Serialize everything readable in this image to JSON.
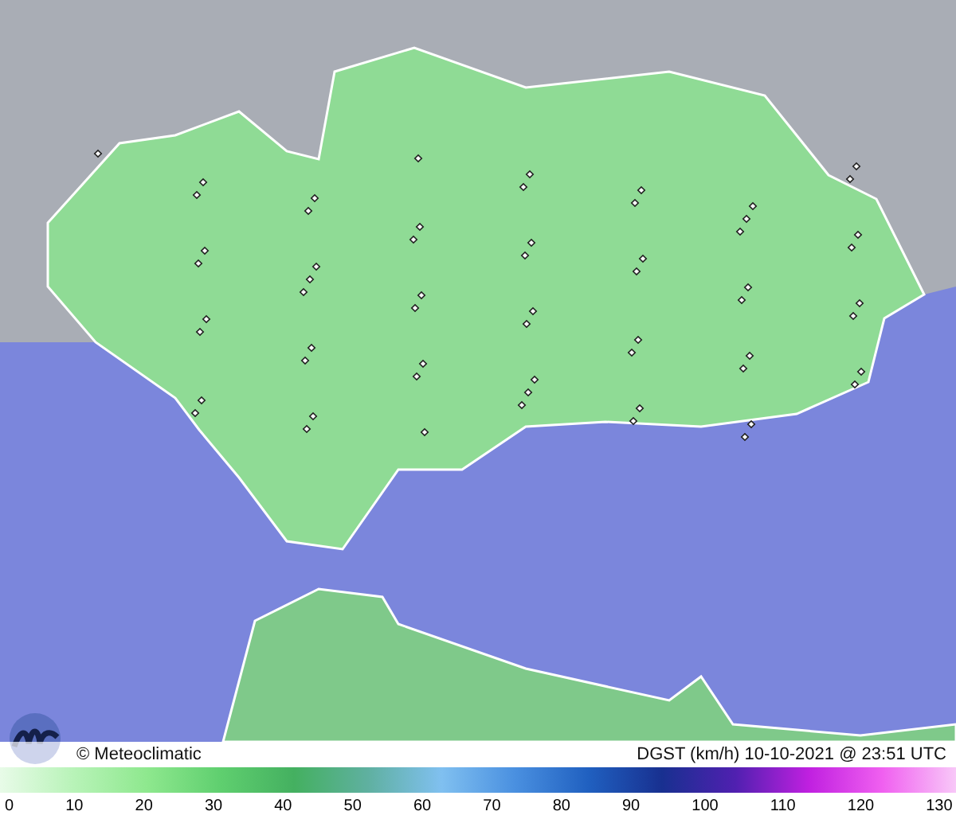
{
  "map": {
    "credit": "© Meteoclimatic",
    "caption": "DGST (km/h)  10-10-2021 @ 23:51 UTC"
  },
  "legend": {
    "ticks": [
      "0",
      "10",
      "20",
      "30",
      "40",
      "50",
      "60",
      "70",
      "80",
      "90",
      "100",
      "110",
      "120",
      "130"
    ]
  }
}
